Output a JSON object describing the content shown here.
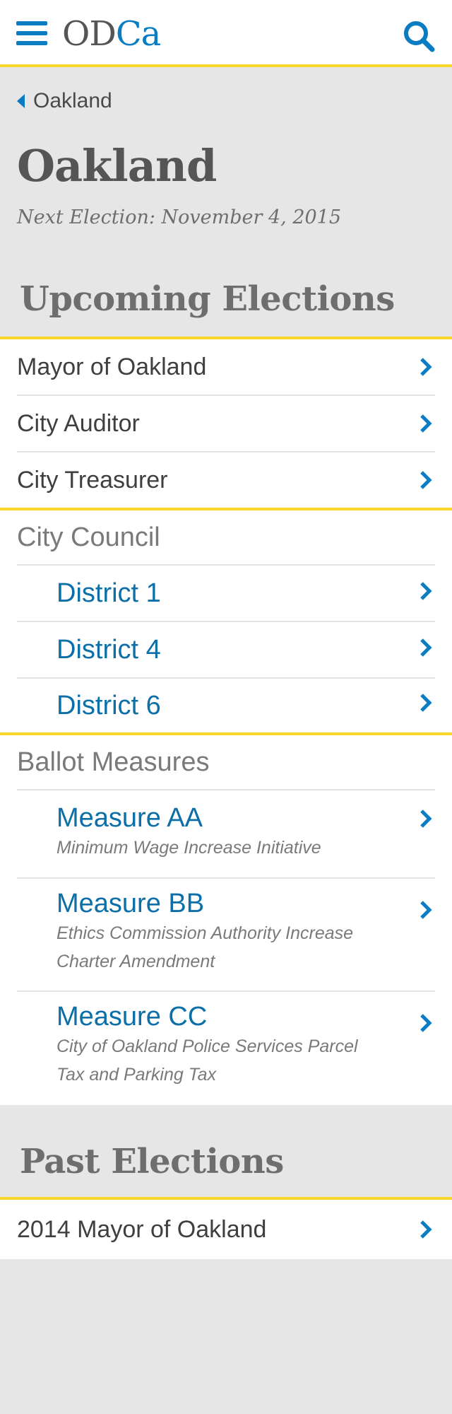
{
  "header": {
    "logo_primary": "OD",
    "logo_accent": "Ca",
    "menu_icon": "hamburger-menu-icon",
    "search_icon": "search-icon",
    "brand_blue": "#0a7cc1",
    "accent_yellow": "#fbd72c"
  },
  "breadcrumb": {
    "label": "Oakland",
    "icon": "caret-left-icon"
  },
  "page": {
    "title": "Oakland",
    "next_election": "Next Election: November 4, 2015"
  },
  "upcoming": {
    "heading": "Upcoming Elections",
    "offices": [
      {
        "label": "Mayor of Oakland"
      },
      {
        "label": "City Auditor"
      },
      {
        "label": "City Treasurer"
      }
    ],
    "city_council": {
      "title": "City Council",
      "districts": [
        {
          "label": "District 1"
        },
        {
          "label": "District 4"
        },
        {
          "label": "District 6"
        }
      ]
    },
    "ballot_measures": {
      "title": "Ballot Measures",
      "measures": [
        {
          "label": "Measure AA",
          "description": "Minimum Wage Increase Initiative"
        },
        {
          "label": "Measure BB",
          "description": "Ethics Commission Authority Increase Charter Amendment"
        },
        {
          "label": "Measure CC",
          "description": "City of Oakland Police Services Parcel Tax and Parking Tax"
        }
      ]
    }
  },
  "past": {
    "heading": "Past Elections",
    "elections": [
      {
        "label": "2014 Mayor of Oakland"
      }
    ]
  },
  "chevron_icon": "chevron-right-icon"
}
